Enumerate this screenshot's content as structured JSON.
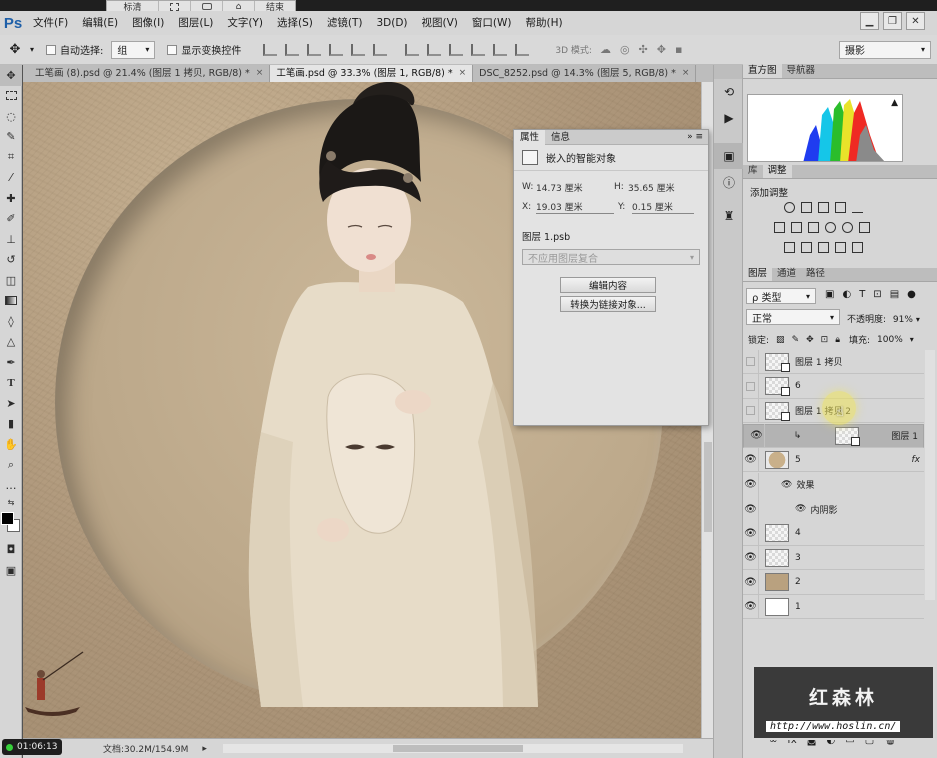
{
  "recorder": {
    "items": [
      "标清",
      "",
      "",
      "结束"
    ]
  },
  "app": {
    "logo": "Ps"
  },
  "menu": [
    "文件(F)",
    "编辑(E)",
    "图像(I)",
    "图层(L)",
    "文字(Y)",
    "选择(S)",
    "滤镜(T)",
    "3D(D)",
    "视图(V)",
    "窗口(W)",
    "帮助(H)"
  ],
  "window_controls": {
    "minimize": "▁",
    "restore": "❐",
    "close": "✕"
  },
  "options": {
    "auto_select_label": "自动选择:",
    "auto_select_value": "组",
    "show_transform_label": "显示变换控件",
    "mode_3d_label": "3D 模式:",
    "workspace_value": "摄影"
  },
  "tabs": [
    {
      "label": "工笔画 (8).psd @ 21.4% (图层 1 拷贝, RGB/8) *",
      "close": "×",
      "active": false
    },
    {
      "label": "工笔画.psd @ 33.3% (图层 1, RGB/8) *",
      "close": "×",
      "active": true
    },
    {
      "label": "DSC_8252.psd @ 14.3% (图层 5, RGB/8) *",
      "close": "×",
      "active": false
    }
  ],
  "status": {
    "doc_info": "文档:30.2M/154.9M",
    "timer": "01:06:13",
    "arrow": "▸"
  },
  "properties": {
    "tab1": "属性",
    "tab2": "信息",
    "object_type": "嵌入的智能对象",
    "w_label": "W:",
    "w_value": "14.73 厘米",
    "h_label": "H:",
    "h_value": "35.65 厘米",
    "x_label": "X:",
    "x_value": "19.03 厘米",
    "y_label": "Y:",
    "y_value": "0.15 厘米",
    "source_file": "图层 1.psb",
    "comp_placeholder": "不应用图层复合",
    "edit_button": "编辑内容",
    "convert_button": "转换为链接对象..."
  },
  "panels": {
    "histogram_tab": "直方图",
    "navigator_tab": "导航器",
    "library_tab": "库",
    "adjust_tab": "调整",
    "add_adjustment": "添加调整",
    "layers_tab": "图层",
    "channels_tab": "通道",
    "paths_tab": "路径"
  },
  "layers_panel": {
    "filter_kind": "类型",
    "blend_mode": "正常",
    "opacity_label": "不透明度:",
    "opacity_value": "91%",
    "lock_label": "锁定:",
    "fill_label": "填充:",
    "fill_value": "100%"
  },
  "layers": [
    {
      "name": "图层 1 拷贝",
      "visible": false,
      "kind": "smart",
      "selected": false
    },
    {
      "name": "6",
      "visible": false,
      "kind": "smart",
      "selected": false
    },
    {
      "name": "图层 1 拷贝 2",
      "visible": false,
      "kind": "smart",
      "selected": false
    },
    {
      "name": "图层 1",
      "visible": true,
      "kind": "smart",
      "selected": true,
      "clipped": true
    },
    {
      "name": "5",
      "visible": true,
      "kind": "tan",
      "selected": false,
      "fx": "fx"
    },
    {
      "name": "效果",
      "visible": true,
      "kind": "effect",
      "selected": false
    },
    {
      "name": "内阴影",
      "visible": true,
      "kind": "effect-item",
      "selected": false
    },
    {
      "name": "4",
      "visible": true,
      "kind": "transparent",
      "selected": false
    },
    {
      "name": "3",
      "visible": true,
      "kind": "transparent",
      "selected": false
    },
    {
      "name": "2",
      "visible": true,
      "kind": "tan-solid",
      "selected": false
    },
    {
      "name": "1",
      "visible": true,
      "kind": "white",
      "selected": false
    }
  ],
  "watermark": {
    "title": "红森林",
    "url": "http://www.hoslin.cn/"
  },
  "colors": {
    "accent": "#1e5fa8",
    "canvas_bg": "#b39c7d",
    "panel_bg": "#d6d6d6"
  }
}
